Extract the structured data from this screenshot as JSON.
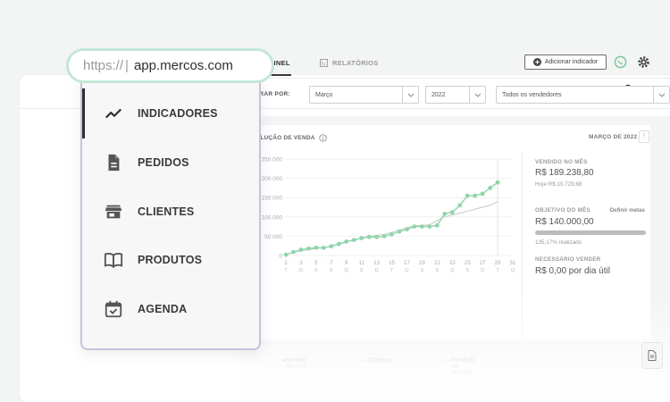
{
  "url": {
    "protocol": "https://",
    "host": "app.mercos.com"
  },
  "menu": {
    "items": [
      {
        "label": "INDICADORES",
        "icon": "trending-up-icon"
      },
      {
        "label": "PEDIDOS",
        "icon": "document-icon"
      },
      {
        "label": "CLIENTES",
        "icon": "store-icon"
      },
      {
        "label": "PRODUTOS",
        "icon": "book-icon"
      },
      {
        "label": "AGENDA",
        "icon": "calendar-check-icon"
      }
    ]
  },
  "tabs": {
    "painel": "PAINEL",
    "relatorios": "RELATÓRIOS"
  },
  "actions": {
    "add_indicator": "Adicionar indicador"
  },
  "filters": {
    "label": "FILTRAR POR:",
    "month": "Março",
    "year": "2022",
    "sellers": "Todos os vendedores"
  },
  "card": {
    "title": "EVOLUÇÃO DE VENDA",
    "date": "MARÇO DE 2022",
    "menu_glyph": "⋮"
  },
  "summary": {
    "sold_label": "VENDIDO NO MÊS",
    "sold_value": "R$ 189.238,80",
    "today_text": "Hoje R$ 10.729,68",
    "goal_label": "OBJETIVO DO MÊS",
    "goal_link": "Definir metas",
    "goal_value": "R$ 140.000,00",
    "realized_text": "135,17% realizado",
    "realized_fraction": 1.0,
    "needed_label": "NECESSÁRIO VENDER",
    "needed_value": "R$ 0,00 por dia útil"
  },
  "legend": {
    "sold": "Vendas no mês",
    "goal": "Objetivo",
    "forecast": "Previsão de vendas"
  },
  "colors": {
    "accent_green": "#8fd5ab",
    "url_border": "#c5e6d6",
    "menu_border": "#c9c2dc"
  },
  "chart_data": {
    "type": "line",
    "y_ticks": [
      "250.000",
      "200.000",
      "150.000",
      "100.000",
      "50.000",
      "0"
    ],
    "ylim": [
      0,
      250000
    ],
    "x_ticks": [
      "1",
      "3",
      "5",
      "7",
      "9",
      "11",
      "13",
      "15",
      "17",
      "19",
      "21",
      "23",
      "25",
      "27",
      "29",
      "31"
    ],
    "x_tick_sub": [
      "T",
      "Q",
      "S",
      "S",
      "Q",
      "S",
      "D",
      "T",
      "Q",
      "S",
      "S",
      "Q",
      "S",
      "D",
      "T",
      "Q"
    ],
    "x": [
      1,
      2,
      3,
      4,
      5,
      6,
      7,
      8,
      9,
      10,
      11,
      12,
      13,
      14,
      15,
      16,
      17,
      18,
      19,
      20,
      21,
      22,
      23,
      24,
      25,
      26,
      27,
      28,
      29
    ],
    "series": [
      {
        "name": "Vendas no mês",
        "values": [
          2000,
          9000,
          15000,
          18000,
          20000,
          20000,
          24000,
          30000,
          36000,
          40000,
          45000,
          48000,
          48000,
          50000,
          55000,
          62000,
          68000,
          75000,
          75000,
          75000,
          78000,
          108000,
          112000,
          130000,
          155000,
          155000,
          160000,
          175000,
          189238
        ]
      },
      {
        "name": "Previsão de vendas",
        "values": [
          3000,
          8000,
          12000,
          15000,
          18000,
          20000,
          25000,
          30000,
          35000,
          40000,
          45000,
          50000,
          52000,
          55000,
          60000,
          66000,
          72000,
          77000,
          78000,
          80000,
          90000,
          100000,
          105000,
          110000,
          115000,
          120000,
          125000,
          130000,
          140000
        ]
      }
    ]
  }
}
